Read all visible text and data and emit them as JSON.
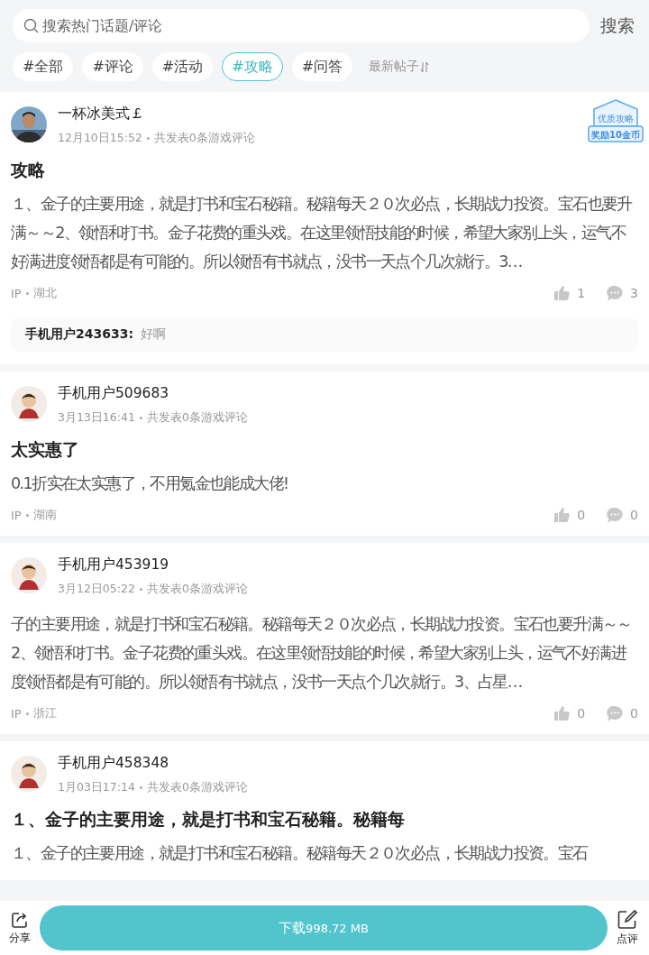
{
  "search": {
    "placeholder": "搜索热门话题/评论",
    "button": "搜索"
  },
  "tags": [
    {
      "label": "#全部",
      "selected": false
    },
    {
      "label": "#评论",
      "selected": false
    },
    {
      "label": "#活动",
      "selected": false
    },
    {
      "label": "#攻略",
      "selected": true
    },
    {
      "label": "#问答",
      "selected": false
    }
  ],
  "sort": {
    "label": "最新帖子"
  },
  "posts": [
    {
      "author": "一杯冰美式￡",
      "time": "12月10日15:52",
      "meta": "共发表0条游戏评论",
      "badge": {
        "title": "优质攻略",
        "reward": "奖励10金币"
      },
      "title": "攻略",
      "body": "１、金子的主要用途，就是打书和宝石秘籍。秘籍每天２０次必点，长期战力投资。宝石也要升满～～2、领悟和打书。金子花费的重头戏。在这里领悟技能的时候，希望大家别上头，运气不好满进度领悟都是有可能的。所以领悟有书就点，没书一天点个几次就行。3…",
      "ip": "IP",
      "region": "湖北",
      "likes": "1",
      "comments": "3",
      "reply": {
        "user": "手机用户243633:",
        "text": "好啊"
      }
    },
    {
      "author": "手机用户509683",
      "avatar": {
        "kind": "cartoon"
      },
      "time": "3月13日16:41",
      "meta": "共发表0条游戏评论",
      "title": "太实惠了",
      "body": "0.1折实在太实惠了，不用氪金也能成大佬!",
      "ip": "IP",
      "region": "湖南",
      "likes": "0",
      "comments": "0"
    },
    {
      "author": "手机用户453919",
      "avatar": {
        "kind": "cartoon"
      },
      "time": "3月12日05:22",
      "meta": "共发表0条游戏评论",
      "body": "子的主要用途，就是打书和宝石秘籍。秘籍每天２０次必点，长期战力投资。宝石也要升满～～2、领悟和打书。金子花费的重头戏。在这里领悟技能的时候，希望大家别上头，运气不好满进度领悟都是有可能的。所以领悟有书就点，没书一天点个几次就行。3、占星…",
      "ip": "IP",
      "region": "浙江",
      "likes": "0",
      "comments": "0"
    },
    {
      "author": "手机用户458348",
      "avatar": {
        "kind": "cartoon"
      },
      "time": "1月03日17:14",
      "meta": "共发表0条游戏评论",
      "title": "１、金子的主要用途，就是打书和宝石秘籍。秘籍每",
      "body": "１、金子的主要用途，就是打书和宝石秘籍。秘籍每天２０次必点，长期战力投资。宝石"
    }
  ],
  "bottom": {
    "share": "分享",
    "download": "下载",
    "size": "998.72 MB",
    "review": "点评"
  }
}
